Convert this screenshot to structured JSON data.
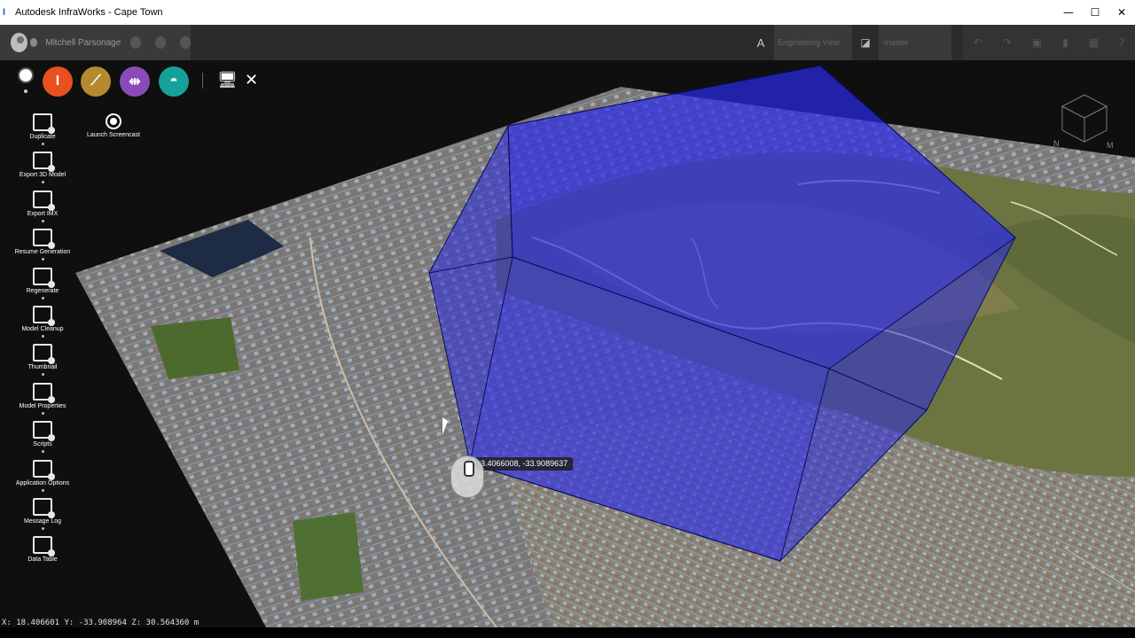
{
  "window": {
    "title": "Autodesk InfraWorks - Cape Town",
    "app_icon": "I",
    "minimize": "—",
    "maximize": "☐",
    "close": "✕"
  },
  "topbar": {
    "user_name": "Mitchell Parsonage",
    "view_icon": "A",
    "view_name": "Engineering View",
    "branch_name": "master",
    "right_icons": [
      "undo-icon",
      "redo-icon",
      "save-icon",
      "bookmark-icon",
      "layout-icon",
      "help-icon"
    ]
  },
  "ribbon": {
    "buttons": [
      {
        "name": "build-manage-analyze",
        "color": "#e8501e",
        "glyph": "I"
      },
      {
        "name": "roads",
        "color": "#b58a2e",
        "glyph": "⟋"
      },
      {
        "name": "bridges",
        "color": "#8a4bb8",
        "glyph": "⇹"
      },
      {
        "name": "drainage",
        "color": "#15a19a",
        "glyph": "◓"
      }
    ],
    "present_icon": "🖥",
    "tools_icon": "✕"
  },
  "sidebar": {
    "items": [
      {
        "label": "Duplicate",
        "icon": "duplicate-icon"
      },
      {
        "label": "Export 3D Model",
        "icon": "export-3d-icon"
      },
      {
        "label": "Export IMX",
        "icon": "export-imx-icon"
      },
      {
        "label": "Resume Generation",
        "icon": "resume-generation-icon"
      },
      {
        "label": "Regenerate",
        "icon": "regenerate-icon"
      },
      {
        "label": "Model Cleanup",
        "icon": "model-cleanup-icon"
      },
      {
        "label": "Thumbnail",
        "icon": "thumbnail-icon"
      },
      {
        "label": "Model Properties",
        "icon": "model-properties-icon"
      },
      {
        "label": "Scripts",
        "icon": "scripts-icon"
      },
      {
        "label": "Application Options",
        "icon": "gear-icon"
      },
      {
        "label": "Message Log",
        "icon": "flag-icon"
      },
      {
        "label": "Data Table",
        "icon": "table-icon"
      }
    ],
    "launch_screencast": "Launch Screencast"
  },
  "viewport": {
    "coord_tooltip": "3.4066008, -33.9089637",
    "viewcube_labels": [
      "N",
      "M"
    ]
  },
  "status": {
    "coordinates": "X: 18.406601 Y: -33.908964 Z: 30.564360 m"
  },
  "colors": {
    "selection_fill": "#2a2ae0",
    "terrain_green": "#6f7a3f",
    "city": "#7d7f86"
  }
}
